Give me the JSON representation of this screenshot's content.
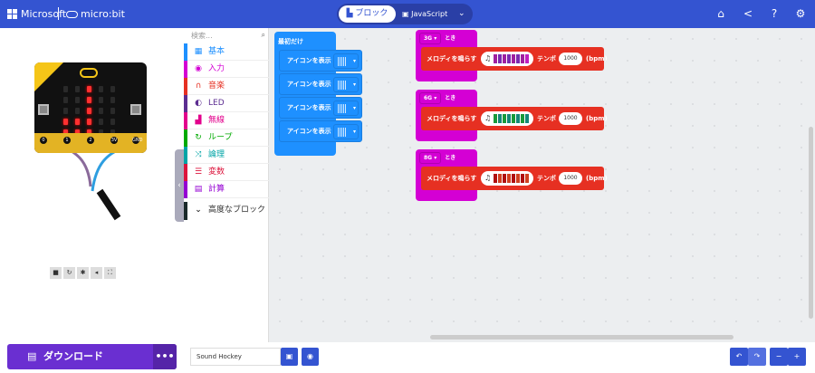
{
  "header": {
    "brand": "Microsoft",
    "product": "micro:bit",
    "tab_blocks": "ブロック",
    "tab_js": "JavaScript",
    "icons": [
      "home-icon",
      "share-icon",
      "help-icon",
      "settings-icon"
    ],
    "color": "#3454d1"
  },
  "simulator": {
    "pins": [
      "0",
      "1",
      "2",
      "3V",
      "GND"
    ],
    "controls": [
      "stop-icon",
      "restart-icon",
      "debug-icon",
      "mute-icon",
      "fullscreen-icon"
    ],
    "leds": [
      [
        0,
        0,
        1,
        0,
        0
      ],
      [
        0,
        0,
        1,
        0,
        0
      ],
      [
        0,
        0,
        1,
        0,
        0
      ],
      [
        1,
        1,
        1,
        0,
        0
      ],
      [
        1,
        1,
        1,
        0,
        0
      ]
    ]
  },
  "toolbox": {
    "search_placeholder": "検索...",
    "categories": [
      {
        "label": "基本",
        "color": "#1e90ff",
        "icon": "grid-icon"
      },
      {
        "label": "入力",
        "color": "#d400d4",
        "icon": "input-icon"
      },
      {
        "label": "音楽",
        "color": "#e63022",
        "icon": "headphones-icon"
      },
      {
        "label": "LED",
        "color": "#5c2d91",
        "icon": "toggle-icon"
      },
      {
        "label": "無線",
        "color": "#e3008c",
        "icon": "signal-icon"
      },
      {
        "label": "ループ",
        "color": "#00aa00",
        "icon": "loop-icon"
      },
      {
        "label": "論理",
        "color": "#00a4a6",
        "icon": "shuffle-icon"
      },
      {
        "label": "変数",
        "color": "#dc143c",
        "icon": "list-icon"
      },
      {
        "label": "計算",
        "color": "#9400d3",
        "icon": "calculator-icon"
      }
    ],
    "advanced": "高度なブロック"
  },
  "workspace": {
    "start_block": {
      "label": "最初だけ",
      "statements": [
        "アイコンを表示",
        "アイコンを表示",
        "アイコンを表示",
        "アイコンを表示"
      ]
    },
    "gesture_blocks": [
      {
        "gesture": "3G",
        "suffix": "とき",
        "action": "メロディを鳴らす",
        "tempo_label": "テンポ",
        "tempo": "1000",
        "unit": "(bpm)",
        "colors": [
          "#a020a0",
          "#7a2ab0",
          "#a020a0",
          "#7a2ab0",
          "#a020a0",
          "#7a2ab0",
          "#a020a0",
          "#c020c0"
        ]
      },
      {
        "gesture": "6G",
        "suffix": "とき",
        "action": "メロディを鳴らす",
        "tempo_label": "テンポ",
        "tempo": "1000",
        "unit": "(bpm)",
        "colors": [
          "#1a9a3a",
          "#13887a",
          "#1a9a3a",
          "#13887a",
          "#1a9a3a",
          "#13887a",
          "#1a9a3a",
          "#13887a"
        ]
      },
      {
        "gesture": "8G",
        "suffix": "とき",
        "action": "メロディを鳴らす",
        "tempo_label": "テンポ",
        "tempo": "1000",
        "unit": "(bpm)",
        "colors": [
          "#b01010",
          "#d04020",
          "#b01010",
          "#d04020",
          "#b01010",
          "#d04020",
          "#b01010",
          "#d04020"
        ]
      }
    ]
  },
  "footer": {
    "download": "ダウンロード",
    "more": "•••",
    "project_name": "Sound Hockey"
  }
}
